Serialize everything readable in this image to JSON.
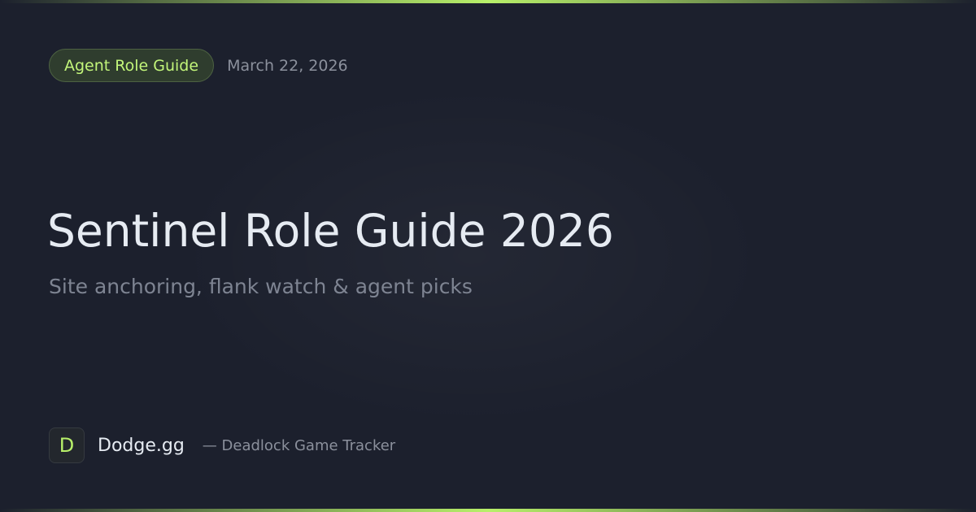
{
  "badge": {
    "label": "Agent Role Guide"
  },
  "date": "March 22, 2026",
  "title": "Sentinel Role Guide 2026",
  "subtitle": "Site anchoring, flank watch & agent picks",
  "brand": {
    "logo_letter": "D",
    "name": "Dodge.gg",
    "tagline": "— Deadlock Game Tracker"
  },
  "colors": {
    "background": "#1c202d",
    "accent": "#b8f06a",
    "title_text": "#e6ebf2",
    "muted_text": "#8b909c"
  }
}
